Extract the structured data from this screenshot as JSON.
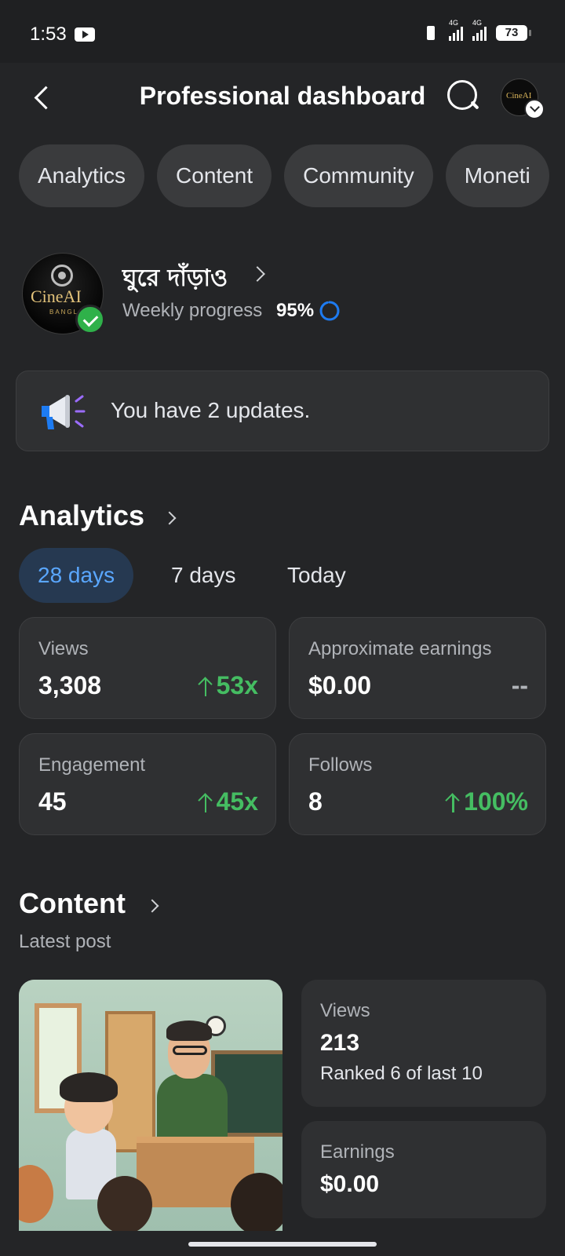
{
  "status_bar": {
    "time": "1:53",
    "network_1": "4G",
    "network_2": "4G",
    "battery": "73"
  },
  "header": {
    "title": "Professional dashboard"
  },
  "tabs": [
    {
      "label": "Analytics"
    },
    {
      "label": "Content"
    },
    {
      "label": "Community"
    },
    {
      "label": "Moneti"
    }
  ],
  "profile": {
    "name": "ঘুরে দাঁড়াও",
    "weekly_progress_label": "Weekly progress",
    "weekly_progress_value": "95%",
    "avatar_text": "CineAI",
    "avatar_subtext": "BANGL"
  },
  "updates": {
    "text": "You have 2 updates."
  },
  "analytics": {
    "title": "Analytics",
    "ranges": [
      {
        "label": "28 days",
        "active": true
      },
      {
        "label": "7 days",
        "active": false
      },
      {
        "label": "Today",
        "active": false
      }
    ],
    "stats": [
      {
        "label": "Views",
        "value": "3,308",
        "change": "53x",
        "trend": "up"
      },
      {
        "label": "Approximate earnings",
        "value": "$0.00",
        "change": "--",
        "trend": "none"
      },
      {
        "label": "Engagement",
        "value": "45",
        "change": "45x",
        "trend": "up"
      },
      {
        "label": "Follows",
        "value": "8",
        "change": "100%",
        "trend": "up"
      }
    ]
  },
  "content": {
    "title": "Content",
    "subtitle": "Latest post",
    "post_views_label": "Views",
    "post_views_value": "213",
    "post_rank": "Ranked 6 of last 10",
    "post_earnings_label": "Earnings",
    "post_earnings_value": "$0.00"
  },
  "colors": {
    "background": "#242527",
    "card": "#2f3032",
    "accent": "#5aa7ff",
    "positive": "#45bd62"
  }
}
